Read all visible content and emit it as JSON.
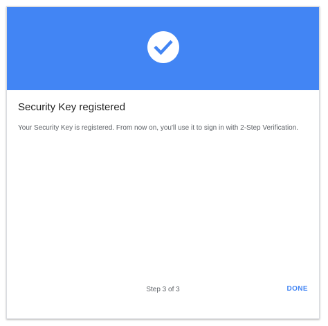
{
  "dialog": {
    "header_color": "#4285f4",
    "icon": "check-circle-icon",
    "title": "Security Key registered",
    "message": "Your Security Key is registered. From now on, you'll use it to sign in with 2-Step Verification.",
    "step_text": "Step 3 of 3",
    "done_label": "DONE"
  }
}
